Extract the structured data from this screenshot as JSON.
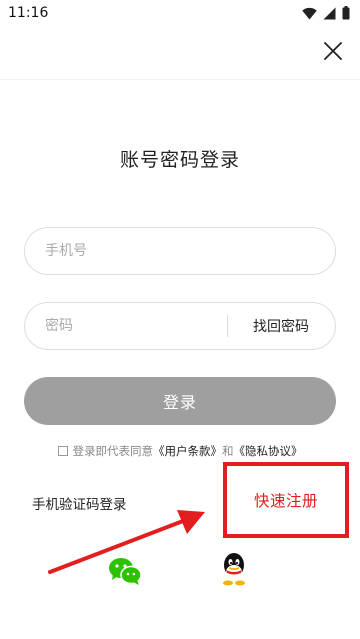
{
  "status_bar": {
    "time": "11:16"
  },
  "header": {
    "close_icon": "close-icon"
  },
  "title": "账号密码登录",
  "form": {
    "phone": {
      "placeholder": "手机号",
      "value": ""
    },
    "password": {
      "placeholder": "密码",
      "value": ""
    },
    "forgot_password_label": "找回密码",
    "login_label": "登录"
  },
  "agreement": {
    "checked": false,
    "prefix": "登录即代表同意",
    "terms_label": "《用户条款》",
    "and": "和",
    "privacy_label": "《隐私协议》"
  },
  "alt_login": {
    "sms_label": "手机验证码登录",
    "register_label": "快速注册"
  },
  "social": {
    "wechat_icon": "wechat-icon",
    "qq_icon": "qq-icon"
  },
  "colors": {
    "accent_red": "#e21e1e",
    "login_button_bg": "#9f9f9f",
    "wechat_green": "#2dc100"
  }
}
